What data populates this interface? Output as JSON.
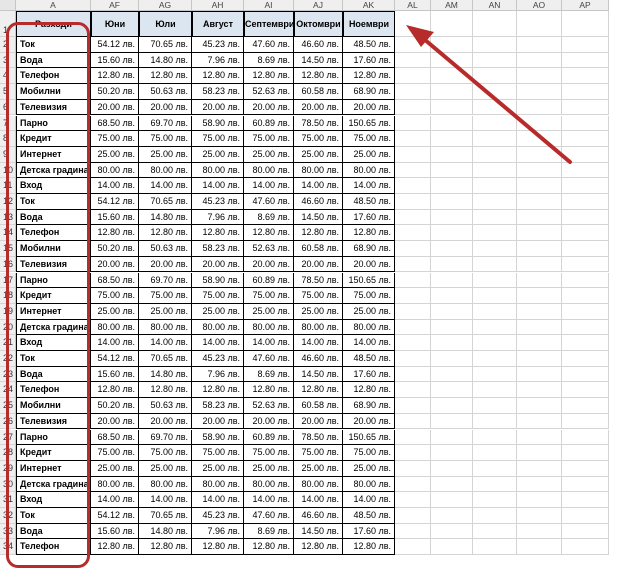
{
  "columns": [
    "A",
    "AF",
    "AG",
    "AH",
    "AI",
    "AJ",
    "AK",
    "AL",
    "AM",
    "AN",
    "AO",
    "AP"
  ],
  "header_row": [
    "Разходи",
    "Юни",
    "Юли",
    "Август",
    "Септември",
    "Октомври",
    "Ноември"
  ],
  "rows": [
    [
      "Ток",
      "54.12 лв.",
      "70.65 лв.",
      "45.23 лв.",
      "47.60 лв.",
      "46.60 лв.",
      "48.50 лв."
    ],
    [
      "Вода",
      "15.60 лв.",
      "14.80 лв.",
      "7.96 лв.",
      "8.69 лв.",
      "14.50 лв.",
      "17.60 лв."
    ],
    [
      "Телефон",
      "12.80 лв.",
      "12.80 лв.",
      "12.80 лв.",
      "12.80 лв.",
      "12.80 лв.",
      "12.80 лв."
    ],
    [
      "Мобилни",
      "50.20 лв.",
      "50.63 лв.",
      "58.23 лв.",
      "52.63 лв.",
      "60.58 лв.",
      "68.90 лв."
    ],
    [
      "Телевизия",
      "20.00 лв.",
      "20.00 лв.",
      "20.00 лв.",
      "20.00 лв.",
      "20.00 лв.",
      "20.00 лв."
    ],
    [
      "Парно",
      "68.50 лв.",
      "69.70 лв.",
      "58.90 лв.",
      "60.89 лв.",
      "78.50 лв.",
      "150.65 лв."
    ],
    [
      "Кредит",
      "75.00 лв.",
      "75.00 лв.",
      "75.00 лв.",
      "75.00 лв.",
      "75.00 лв.",
      "75.00 лв."
    ],
    [
      "Интернет",
      "25.00 лв.",
      "25.00 лв.",
      "25.00 лв.",
      "25.00 лв.",
      "25.00 лв.",
      "25.00 лв."
    ],
    [
      "Детска градина",
      "80.00 лв.",
      "80.00 лв.",
      "80.00 лв.",
      "80.00 лв.",
      "80.00 лв.",
      "80.00 лв."
    ],
    [
      "Вход",
      "14.00 лв.",
      "14.00 лв.",
      "14.00 лв.",
      "14.00 лв.",
      "14.00 лв.",
      "14.00 лв."
    ],
    [
      "Ток",
      "54.12 лв.",
      "70.65 лв.",
      "45.23 лв.",
      "47.60 лв.",
      "46.60 лв.",
      "48.50 лв."
    ],
    [
      "Вода",
      "15.60 лв.",
      "14.80 лв.",
      "7.96 лв.",
      "8.69 лв.",
      "14.50 лв.",
      "17.60 лв."
    ],
    [
      "Телефон",
      "12.80 лв.",
      "12.80 лв.",
      "12.80 лв.",
      "12.80 лв.",
      "12.80 лв.",
      "12.80 лв."
    ],
    [
      "Мобилни",
      "50.20 лв.",
      "50.63 лв.",
      "58.23 лв.",
      "52.63 лв.",
      "60.58 лв.",
      "68.90 лв."
    ],
    [
      "Телевизия",
      "20.00 лв.",
      "20.00 лв.",
      "20.00 лв.",
      "20.00 лв.",
      "20.00 лв.",
      "20.00 лв."
    ],
    [
      "Парно",
      "68.50 лв.",
      "69.70 лв.",
      "58.90 лв.",
      "60.89 лв.",
      "78.50 лв.",
      "150.65 лв."
    ],
    [
      "Кредит",
      "75.00 лв.",
      "75.00 лв.",
      "75.00 лв.",
      "75.00 лв.",
      "75.00 лв.",
      "75.00 лв."
    ],
    [
      "Интернет",
      "25.00 лв.",
      "25.00 лв.",
      "25.00 лв.",
      "25.00 лв.",
      "25.00 лв.",
      "25.00 лв."
    ],
    [
      "Детска градина",
      "80.00 лв.",
      "80.00 лв.",
      "80.00 лв.",
      "80.00 лв.",
      "80.00 лв.",
      "80.00 лв."
    ],
    [
      "Вход",
      "14.00 лв.",
      "14.00 лв.",
      "14.00 лв.",
      "14.00 лв.",
      "14.00 лв.",
      "14.00 лв."
    ],
    [
      "Ток",
      "54.12 лв.",
      "70.65 лв.",
      "45.23 лв.",
      "47.60 лв.",
      "46.60 лв.",
      "48.50 лв."
    ],
    [
      "Вода",
      "15.60 лв.",
      "14.80 лв.",
      "7.96 лв.",
      "8.69 лв.",
      "14.50 лв.",
      "17.60 лв."
    ],
    [
      "Телефон",
      "12.80 лв.",
      "12.80 лв.",
      "12.80 лв.",
      "12.80 лв.",
      "12.80 лв.",
      "12.80 лв."
    ],
    [
      "Мобилни",
      "50.20 лв.",
      "50.63 лв.",
      "58.23 лв.",
      "52.63 лв.",
      "60.58 лв.",
      "68.90 лв."
    ],
    [
      "Телевизия",
      "20.00 лв.",
      "20.00 лв.",
      "20.00 лв.",
      "20.00 лв.",
      "20.00 лв.",
      "20.00 лв."
    ],
    [
      "Парно",
      "68.50 лв.",
      "69.70 лв.",
      "58.90 лв.",
      "60.89 лв.",
      "78.50 лв.",
      "150.65 лв."
    ],
    [
      "Кредит",
      "75.00 лв.",
      "75.00 лв.",
      "75.00 лв.",
      "75.00 лв.",
      "75.00 лв.",
      "75.00 лв."
    ],
    [
      "Интернет",
      "25.00 лв.",
      "25.00 лв.",
      "25.00 лв.",
      "25.00 лв.",
      "25.00 лв.",
      "25.00 лв."
    ],
    [
      "Детска градина",
      "80.00 лв.",
      "80.00 лв.",
      "80.00 лв.",
      "80.00 лв.",
      "80.00 лв.",
      "80.00 лв."
    ],
    [
      "Вход",
      "14.00 лв.",
      "14.00 лв.",
      "14.00 лв.",
      "14.00 лв.",
      "14.00 лв.",
      "14.00 лв."
    ],
    [
      "Ток",
      "54.12 лв.",
      "70.65 лв.",
      "45.23 лв.",
      "47.60 лв.",
      "46.60 лв.",
      "48.50 лв."
    ],
    [
      "Вода",
      "15.60 лв.",
      "14.80 лв.",
      "7.96 лв.",
      "8.69 лв.",
      "14.50 лв.",
      "17.60 лв."
    ],
    [
      "Телефон",
      "12.80 лв.",
      "12.80 лв.",
      "12.80 лв.",
      "12.80 лв.",
      "12.80 лв.",
      "12.80 лв."
    ]
  ],
  "annotation_color": "#b72b2b",
  "header_fill_color": "#dce6f1"
}
